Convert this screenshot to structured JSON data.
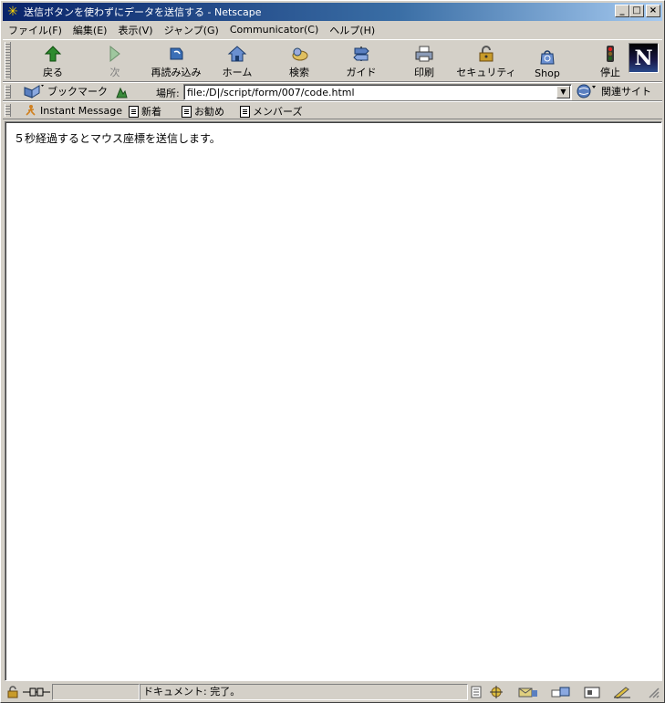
{
  "window": {
    "title": "送信ボタンを使わずにデータを送信する - Netscape",
    "controls": {
      "minimize": "_",
      "maximize": "□",
      "close": "×"
    }
  },
  "menubar": [
    "ファイル(F)",
    "編集(E)",
    "表示(V)",
    "ジャンプ(G)",
    "Communicator(C)",
    "ヘルプ(H)"
  ],
  "nav_toolbar": {
    "back": "戻る",
    "forward": "次",
    "reload": "再読み込み",
    "home": "ホーム",
    "search": "検索",
    "guide": "ガイド",
    "print": "印刷",
    "security": "セキュリティ",
    "shop": "Shop",
    "stop": "停止",
    "logo": "N"
  },
  "location_toolbar": {
    "bookmarks": "ブックマーク",
    "location_label": "場所:",
    "url": "file:/D|/script/form/007/code.html",
    "related": "関連サイト"
  },
  "personal_toolbar": {
    "instant_message": "Instant Message",
    "new": "新着",
    "recommend": "お勧め",
    "members": "メンバーズ"
  },
  "content": {
    "message": "５秒経過するとマウス座標を送信します。"
  },
  "statusbar": {
    "status": "ドキュメント: 完了。"
  },
  "colors": {
    "title_gradient_start": "#0a246a",
    "title_gradient_end": "#a6caf0",
    "chrome": "#d4d0c8",
    "page_background": "#ffffff"
  }
}
